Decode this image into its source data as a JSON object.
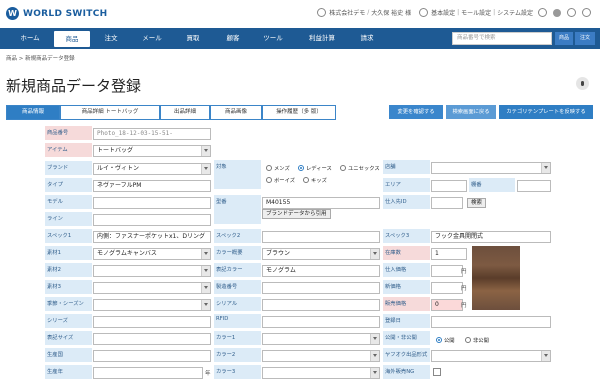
{
  "header": {
    "logo_mark": "W",
    "logo_text": "WORLD SWITCH",
    "company": "株式会社デモ",
    "user": "大久保 裕史 様",
    "separator": "/",
    "basic_settings": "基本設定",
    "mall_settings": "モール設定",
    "system_settings": "システム設定"
  },
  "nav": {
    "items": [
      "ホーム",
      "商品",
      "注文",
      "メール",
      "買取",
      "顧客",
      "ツール",
      "利益計算",
      "請求"
    ],
    "active_index": 1,
    "search_placeholder": "商品番号で検索",
    "search_button": "商品",
    "extra_button": "注文"
  },
  "breadcrumb": "商品 > 新規商品データ登録",
  "page_title": "新規商品データ登録",
  "tabs": [
    "商品情報",
    "商品詳細 トートバッグ",
    "出品詳細",
    "商品画像",
    "操作履歴（多 版）"
  ],
  "actions": {
    "confirm": "変更を確認する",
    "back": "検索画面に戻る",
    "category_template": "カテゴリテンプレートを反映する"
  },
  "form": {
    "col1": [
      {
        "label": "商品番号",
        "value": "Photo_18-12-03-15-51-",
        "type": "text-mono",
        "required": true
      },
      {
        "label": "アイテム",
        "value": "トートバッグ",
        "type": "select",
        "required": true
      },
      {
        "label": "ブランド",
        "value": "ルイ・ヴィトン",
        "type": "select"
      },
      {
        "label": "タイプ",
        "value": "ネヴァーフルPM",
        "type": "text"
      },
      {
        "label": "モデル",
        "value": "",
        "type": "text"
      },
      {
        "label": "ライン",
        "value": "",
        "type": "text"
      },
      {
        "label": "スペック1",
        "value": "内側：ファスナーポケットx1、Dリング",
        "type": "text"
      },
      {
        "label": "素材1",
        "value": "モノグラムキャンバス",
        "type": "select"
      },
      {
        "label": "素材2",
        "value": "",
        "type": "select"
      },
      {
        "label": "素材3",
        "value": "",
        "type": "select"
      },
      {
        "label": "季節・シーズン",
        "value": "",
        "type": "select"
      },
      {
        "label": "シリーズ",
        "value": "",
        "type": "text"
      },
      {
        "label": "表記サイズ",
        "value": "",
        "type": "text"
      },
      {
        "label": "生産国",
        "value": "",
        "type": "text"
      },
      {
        "label": "生産年",
        "value": "",
        "type": "text",
        "unit": "年"
      }
    ],
    "col2": {
      "target_label": "対象",
      "radios": [
        {
          "label": "メンズ",
          "checked": false
        },
        {
          "label": "レディース",
          "checked": true
        },
        {
          "label": "ユニセックス",
          "checked": false
        },
        {
          "label": "ボーイズ",
          "checked": false
        },
        {
          "label": "キッズ",
          "checked": false
        }
      ],
      "model_label": "型番",
      "model_value": "M40155",
      "brand_ref_button": "ブランドデータから引用",
      "spec2_label": "スペック2",
      "color_label": "カラー概要",
      "color_value": "ブラウン",
      "display_color_label": "表記カラー",
      "display_color_value": "モノグラム",
      "serial_number_label": "製造番号",
      "serial_label": "シリアル",
      "rfid_label": "RFID",
      "color1_label": "カラー1",
      "color2_label": "カラー2",
      "color3_label": "カラー3"
    },
    "col3": {
      "store_label": "店舗",
      "area_label": "エリア",
      "shelf_label": "棚番",
      "supplier_label": "仕入先ID",
      "search_button": "検索",
      "spec3_label": "スペック3",
      "spec3_value": "フック金具開閉式",
      "stock_label": "在庫数",
      "stock_value": "1",
      "purchase_price_label": "仕入価格",
      "list_price_label": "新価格",
      "sale_price_label": "販売価格",
      "sale_price_value": "0",
      "yen": "円",
      "reg_date_label": "登録日",
      "visibility_label": "公開・非公開",
      "public": "公開",
      "private": "非公開",
      "yahoo_label": "ヤフオク出品形式",
      "ng_label": "海外販売NG"
    }
  }
}
